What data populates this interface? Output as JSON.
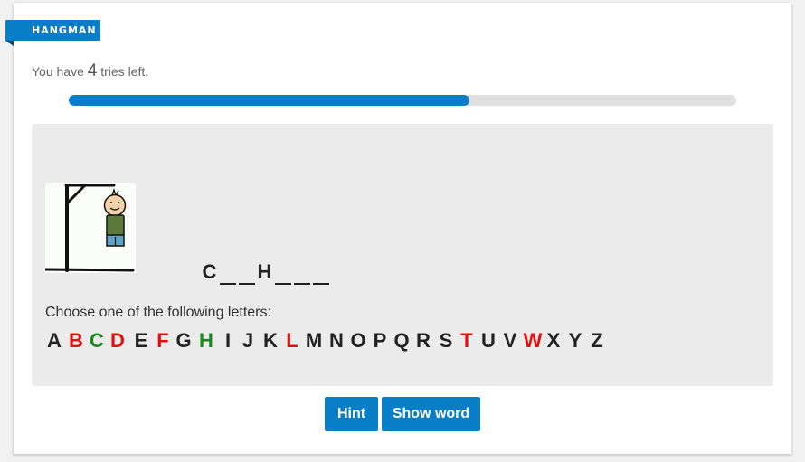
{
  "header": {
    "title": "HANGMAN"
  },
  "status": {
    "tries_prefix": "You have",
    "tries_count": "4",
    "tries_suffix": "tries left.",
    "progress_fraction": 0.6
  },
  "game": {
    "word_slots": [
      "C",
      "",
      "",
      "H",
      "",
      "",
      ""
    ],
    "prompt": "Choose one of the following letters:",
    "letters": [
      {
        "char": "A",
        "state": "unused"
      },
      {
        "char": "B",
        "state": "wrong"
      },
      {
        "char": "C",
        "state": "correct"
      },
      {
        "char": "D",
        "state": "wrong"
      },
      {
        "char": "E",
        "state": "unused"
      },
      {
        "char": "F",
        "state": "wrong"
      },
      {
        "char": "G",
        "state": "unused"
      },
      {
        "char": "H",
        "state": "correct"
      },
      {
        "char": "I",
        "state": "unused"
      },
      {
        "char": "J",
        "state": "unused"
      },
      {
        "char": "K",
        "state": "unused"
      },
      {
        "char": "L",
        "state": "wrong"
      },
      {
        "char": "M",
        "state": "unused"
      },
      {
        "char": "N",
        "state": "unused"
      },
      {
        "char": "O",
        "state": "unused"
      },
      {
        "char": "P",
        "state": "unused"
      },
      {
        "char": "Q",
        "state": "unused"
      },
      {
        "char": "R",
        "state": "unused"
      },
      {
        "char": "S",
        "state": "unused"
      },
      {
        "char": "T",
        "state": "wrong"
      },
      {
        "char": "U",
        "state": "unused"
      },
      {
        "char": "V",
        "state": "unused"
      },
      {
        "char": "W",
        "state": "wrong"
      },
      {
        "char": "X",
        "state": "unused"
      },
      {
        "char": "Y",
        "state": "unused"
      },
      {
        "char": "Z",
        "state": "unused"
      }
    ]
  },
  "buttons": {
    "hint_label": "Hint",
    "show_word_label": "Show word"
  },
  "colors": {
    "accent": "#0a7dc7",
    "letter_unused": "#222222",
    "letter_wrong": "#e01010",
    "letter_correct": "#1a8a1a"
  }
}
